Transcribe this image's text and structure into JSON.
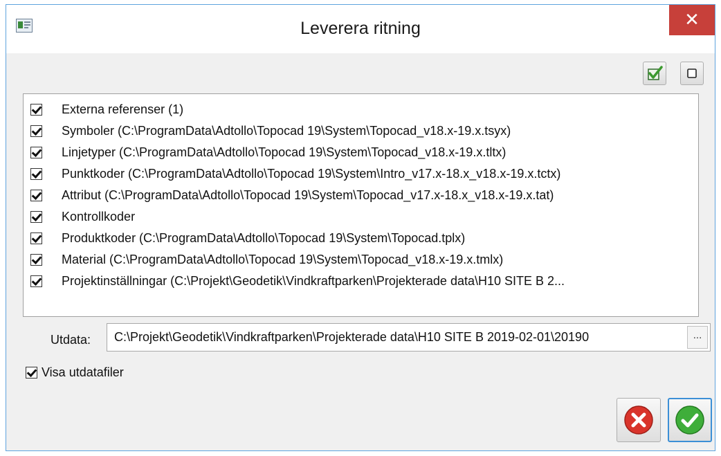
{
  "window": {
    "title": "Leverera ritning",
    "close_glyph": "✕",
    "app_icon": "app-icon"
  },
  "toolbar": {
    "check_all_icon": "check-all-icon",
    "uncheck_all_icon": "uncheck-all-icon"
  },
  "items": [
    {
      "label": "Externa referenser (1)",
      "checked": true
    },
    {
      "label": "Symboler (C:\\ProgramData\\Adtollo\\Topocad 19\\System\\Topocad_v18.x-19.x.tsyx)",
      "checked": true
    },
    {
      "label": "Linjetyper (C:\\ProgramData\\Adtollo\\Topocad 19\\System\\Topocad_v18.x-19.x.tltx)",
      "checked": true
    },
    {
      "label": "Punktkoder (C:\\ProgramData\\Adtollo\\Topocad 19\\System\\Intro_v17.x-18.x_v18.x-19.x.tctx)",
      "checked": true
    },
    {
      "label": "Attribut (C:\\ProgramData\\Adtollo\\Topocad 19\\System\\Topocad_v17.x-18.x_v18.x-19.x.tat)",
      "checked": true
    },
    {
      "label": "Kontrollkoder",
      "checked": true
    },
    {
      "label": "Produktkoder (C:\\ProgramData\\Adtollo\\Topocad 19\\System\\Topocad.tplx)",
      "checked": true
    },
    {
      "label": "Material (C:\\ProgramData\\Adtollo\\Topocad 19\\System\\Topocad_v18.x-19.x.tmlx)",
      "checked": true
    },
    {
      "label": "Projektinställningar (C:\\Projekt\\Geodetik\\Vindkraftparken\\Projekterade data\\H10 SITE B 2...",
      "checked": true
    }
  ],
  "output": {
    "label": "Utdata:",
    "value": "C:\\Projekt\\Geodetik\\Vindkraftparken\\Projekterade data\\H10 SITE B 2019-02-01\\20190",
    "browse_label": "..."
  },
  "show_output": {
    "label": "Visa utdatafiler",
    "checked": true
  },
  "buttons": {
    "cancel_icon": "cancel-icon",
    "ok_icon": "ok-icon"
  },
  "colors": {
    "close_red": "#c7403a",
    "cancel_red": "#d9342b",
    "ok_green": "#3fae3a",
    "accent_blue": "#3b8fd6"
  }
}
